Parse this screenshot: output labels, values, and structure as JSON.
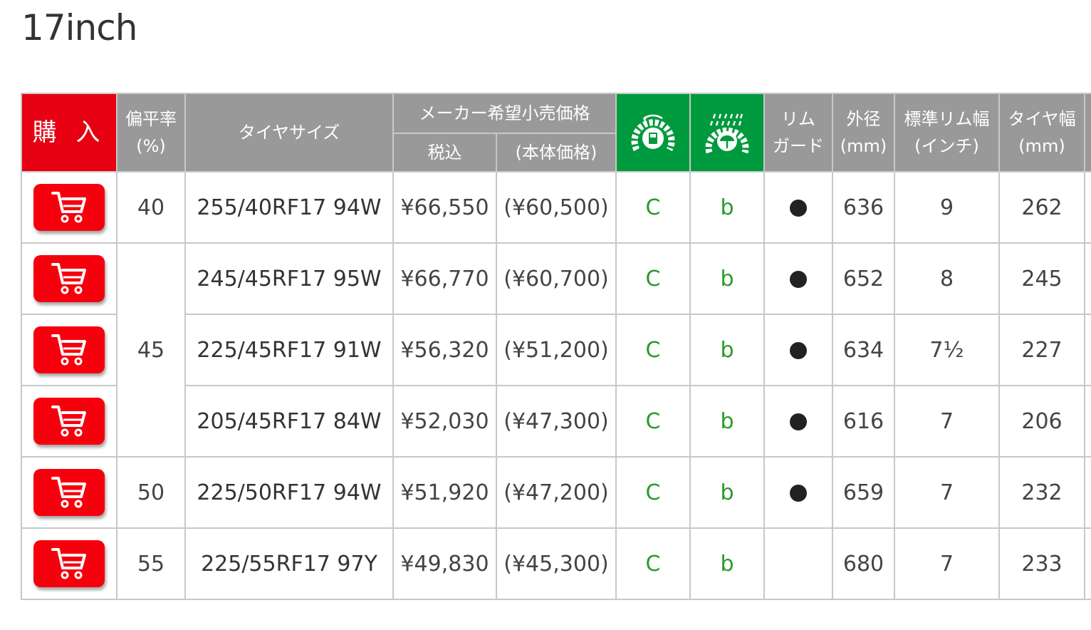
{
  "page": {
    "title": "17inch"
  },
  "header": {
    "buy": "購 入",
    "aspect_line1": "偏平率",
    "aspect_line2": "(%)",
    "tire_size": "タイヤサイズ",
    "price_group": "メーカー希望小売価格",
    "price_tax": "税込",
    "price_base": "(本体価格)",
    "fuel_icon": "fuel-efficiency-icon",
    "wet_icon": "wet-grip-icon",
    "rim_line1": "リム",
    "rim_line2": "ガード",
    "diameter_line1": "外径",
    "diameter_line2": "(mm)",
    "rimwidth_line1": "標準リム幅",
    "rimwidth_line2": "(インチ)",
    "tirewidth_line1": "タイヤ幅",
    "tirewidth_line2": "(mm)"
  },
  "colors": {
    "buy_red": "#e60012",
    "header_gray": "#999999",
    "label_green": "#009a3e",
    "grade_green": "#2a9a2a"
  },
  "rows": [
    {
      "aspect": "40",
      "size": "255/40RF17 94W",
      "price": "¥66,550",
      "base": "(¥60,500)",
      "fuel": "C",
      "wet": "b",
      "rim_guard": true,
      "diameter": "636",
      "rim_width": "9",
      "tire_width": "262"
    },
    {
      "aspect": "45",
      "size": "245/45RF17 95W",
      "price": "¥66,770",
      "base": "(¥60,700)",
      "fuel": "C",
      "wet": "b",
      "rim_guard": true,
      "diameter": "652",
      "rim_width": "8",
      "tire_width": "245"
    },
    {
      "aspect": "",
      "size": "225/45RF17 91W",
      "price": "¥56,320",
      "base": "(¥51,200)",
      "fuel": "C",
      "wet": "b",
      "rim_guard": true,
      "diameter": "634",
      "rim_width": "7½",
      "tire_width": "227"
    },
    {
      "aspect": "",
      "size": "205/45RF17 84W",
      "price": "¥52,030",
      "base": "(¥47,300)",
      "fuel": "C",
      "wet": "b",
      "rim_guard": true,
      "diameter": "616",
      "rim_width": "7",
      "tire_width": "206"
    },
    {
      "aspect": "50",
      "size": "225/50RF17 94W",
      "price": "¥51,920",
      "base": "(¥47,200)",
      "fuel": "C",
      "wet": "b",
      "rim_guard": true,
      "diameter": "659",
      "rim_width": "7",
      "tire_width": "232"
    },
    {
      "aspect": "55",
      "size": "225/55RF17 97Y",
      "price": "¥49,830",
      "base": "(¥45,300)",
      "fuel": "C",
      "wet": "b",
      "rim_guard": false,
      "diameter": "680",
      "rim_width": "7",
      "tire_width": "233"
    }
  ],
  "row_icon": "cart-icon",
  "rim_guard_icon": "filled-circle-icon"
}
